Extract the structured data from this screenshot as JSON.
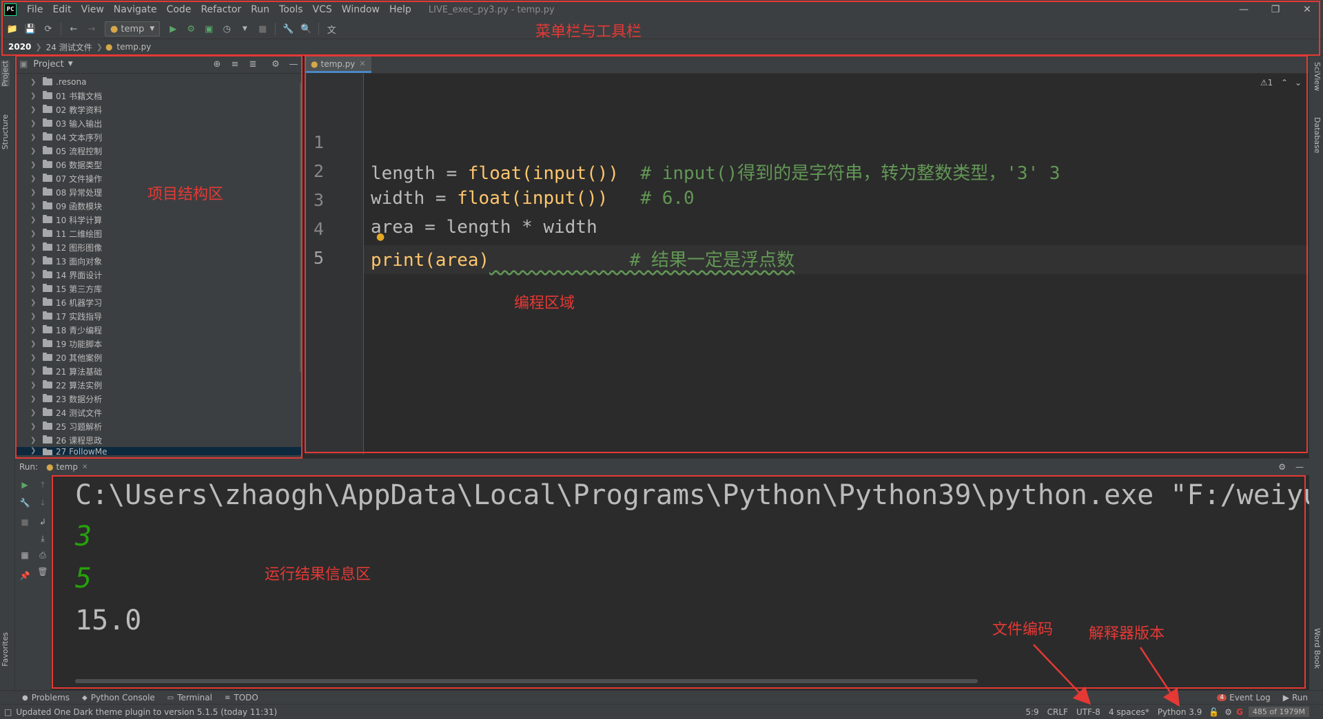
{
  "app": {
    "logo": "PC",
    "window_title": "LIVE_exec_py3.py - temp.py"
  },
  "menu": [
    "File",
    "Edit",
    "View",
    "Navigate",
    "Code",
    "Refactor",
    "Run",
    "Tools",
    "VCS",
    "Window",
    "Help"
  ],
  "toolbar": {
    "run_config": "temp"
  },
  "breadcrumb": [
    "2020",
    "24 测试文件",
    "temp.py"
  ],
  "left_stripe": {
    "project": "Project",
    "structure": "Structure",
    "favorites": "Favorites"
  },
  "right_stripe": {
    "sciview": "SciView",
    "database": "Database",
    "wordbook": "Word Book"
  },
  "project": {
    "title": "Project",
    "items": [
      ".resona",
      "01 书籍文档",
      "02 教学资料",
      "03 输入输出",
      "04 文本序列",
      "05 流程控制",
      "06 数据类型",
      "07 文件操作",
      "08 异常处理",
      "09 函数模块",
      "10 科学计算",
      "11 二维绘图",
      "12 图形图像",
      "13 面向对象",
      "14 界面设计",
      "15 第三方库",
      "16 机器学习",
      "17 实践指导",
      "18 青少编程",
      "19 功能脚本",
      "20 其他案例",
      "21 算法基础",
      "22 算法实例",
      "23 数据分析",
      "24 测试文件",
      "25 习题解析",
      "26 课程思政",
      "27 FollowMe"
    ]
  },
  "editor": {
    "tab": "temp.py",
    "line_numbers": [
      "1",
      "2",
      "3",
      "4",
      "5"
    ],
    "inspection": "⚠1",
    "lines": {
      "l2_var": "length",
      "l2_eq": " = ",
      "l2_float": "float",
      "l2_po": "(",
      "l2_input": "input",
      "l2_pc": "())",
      "l2_comment": "  # input()得到的是字符串，转为整数类型，'3' 3",
      "l3_var": "width",
      "l3_eq": " = ",
      "l3_float": "float",
      "l3_po": "(",
      "l3_input": "input",
      "l3_pc": "())",
      "l3_comment": "   # 6.0",
      "l4_text": "area = length * width",
      "l5_print": "print",
      "l5_args": "(area)",
      "l5_comment": "             # 结果一定是浮点数"
    }
  },
  "run": {
    "label": "Run:",
    "tab": "temp",
    "output": [
      "C:\\Users\\zhaogh\\AppData\\Local\\Programs\\Python\\Python39\\python.exe \"F:/weiyun",
      "3",
      "5",
      "15.0"
    ]
  },
  "bottom_tabs": [
    "Problems",
    "Python Console",
    "Terminal",
    "TODO"
  ],
  "bottom_right": {
    "event_count": "4",
    "event_log": "Event Log",
    "run": "Run"
  },
  "status": {
    "message": "Updated One Dark theme plugin to version 5.1.5 (today 11:31)",
    "position": "5:9",
    "line_sep": "CRLF",
    "encoding": "UTF-8",
    "indent": "4 spaces*",
    "interpreter": "Python 3.9",
    "memory": "485 of 1979M"
  },
  "annotations": {
    "menubar": "菜单栏与工具栏",
    "project": "项目结构区",
    "editor": "编程区域",
    "run": "运行结果信息区",
    "encoding": "文件编码",
    "interpreter": "解释器版本"
  },
  "colors": {
    "annotation": "#e53935",
    "accent": "#4a88c7",
    "bg": "#2b2b2b",
    "panel": "#3c3f41"
  }
}
